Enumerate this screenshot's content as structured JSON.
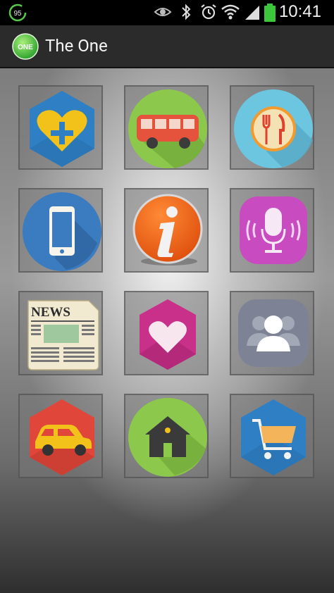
{
  "status_bar": {
    "battery_level": "95",
    "time": "10:41",
    "icons": [
      "battery-saver-icon",
      "eye-icon",
      "bluetooth-icon",
      "alarm-icon",
      "wifi-icon",
      "signal-icon",
      "battery-icon"
    ]
  },
  "app_bar": {
    "logo_text": "ONE",
    "title": "The One"
  },
  "tiles": [
    {
      "icon": "heart-plus-icon"
    },
    {
      "icon": "bus-icon"
    },
    {
      "icon": "restaurant-icon"
    },
    {
      "icon": "smartphone-icon"
    },
    {
      "icon": "info-icon"
    },
    {
      "icon": "microphone-icon"
    },
    {
      "icon": "newspaper-icon",
      "label": "NEWS"
    },
    {
      "icon": "heart-icon"
    },
    {
      "icon": "contacts-icon"
    },
    {
      "icon": "car-icon"
    },
    {
      "icon": "home-icon"
    },
    {
      "icon": "shopping-cart-icon"
    }
  ],
  "colors": {
    "status_bar": "#000000",
    "action_bar": "#2b2b2b",
    "battery_green": "#3cc63c"
  }
}
